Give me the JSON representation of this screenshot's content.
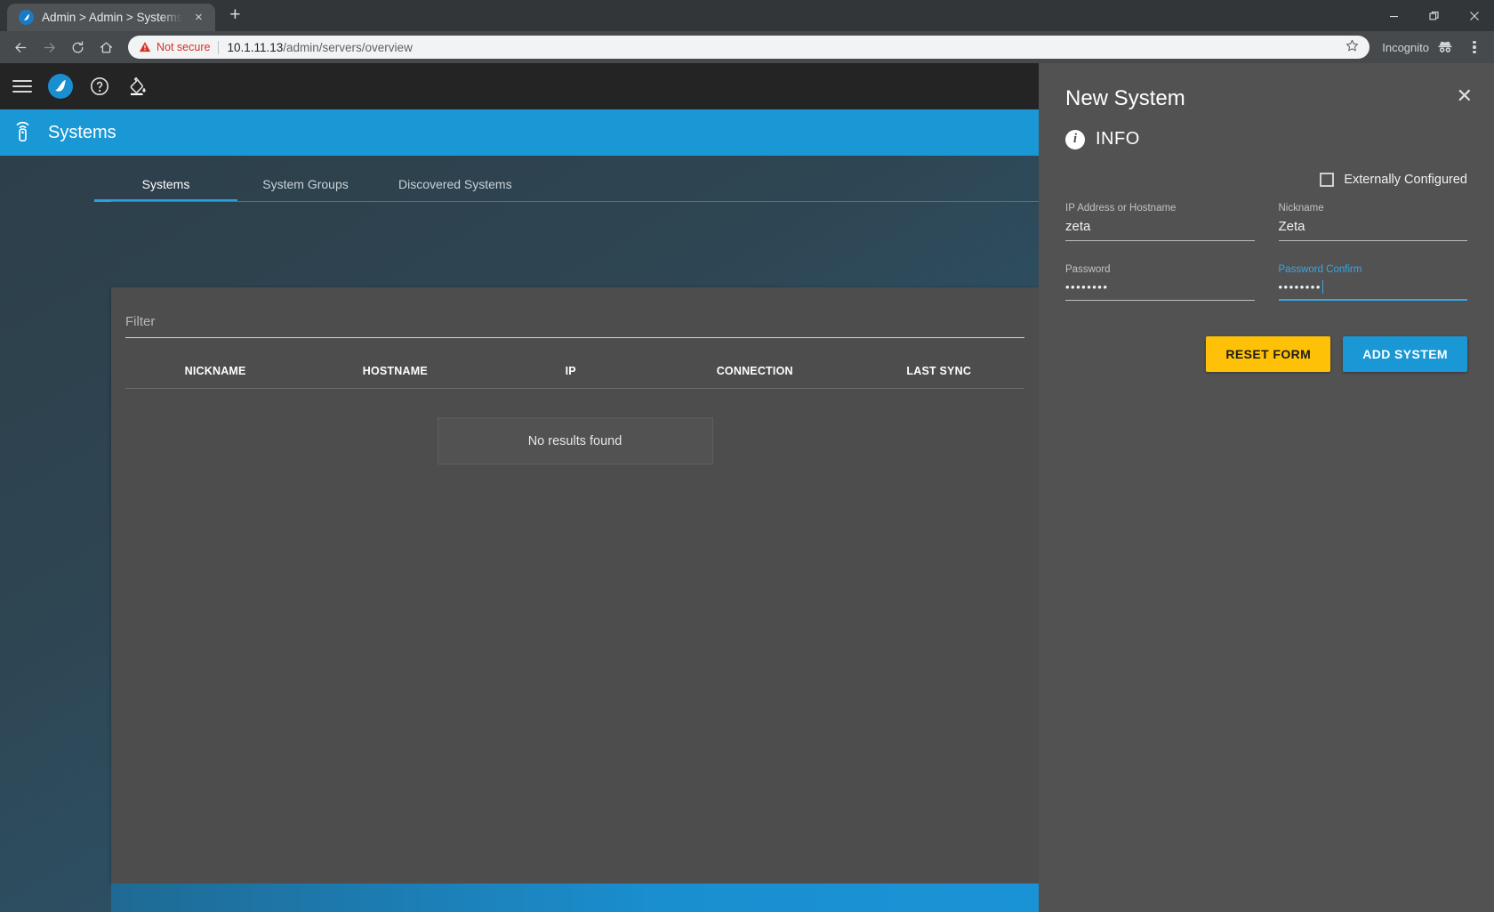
{
  "browser": {
    "tab": {
      "title": "Admin > Admin > Systems",
      "close_label": "×",
      "favicon": "app-logo-icon"
    },
    "newtab_label": "+",
    "window_controls": {
      "minimize": "–",
      "restore": "❐",
      "close": "✕"
    },
    "nav": {
      "back": "←",
      "forward": "→",
      "reload": "↻",
      "home": "⌂"
    },
    "omnibox": {
      "security_label": "Not secure",
      "url_host": "10.1.11.13",
      "url_path": "/admin/servers/overview",
      "bookmark_icon": "star-icon"
    },
    "profile_label": "Incognito",
    "menu_icon": "kebab-menu-icon"
  },
  "appbar": {
    "menu_icon": "hamburger-menu-icon",
    "logo_icon": "brand-logo-icon",
    "help_icon": "help-circle-icon",
    "theme_icon": "paint-fill-icon",
    "settings_icon": "gear-icon",
    "settings_badge_icon": "update-badge-icon",
    "avatar_icon": "user-avatar-icon"
  },
  "page": {
    "icon": "remote-control-icon",
    "title": "Systems"
  },
  "tabs": [
    {
      "label": "Systems",
      "active": true
    },
    {
      "label": "System Groups",
      "active": false
    },
    {
      "label": "Discovered Systems",
      "active": false
    }
  ],
  "table": {
    "filter_placeholder": "Filter",
    "filter_value": "",
    "columns": [
      "NICKNAME",
      "HOSTNAME",
      "IP",
      "CONNECTION",
      "LAST SYNC"
    ],
    "rows": [],
    "empty_message": "No results found"
  },
  "drawer": {
    "title": "New System",
    "close_label": "✕",
    "section_icon": "info-icon",
    "section_label": "INFO",
    "externally_configured": {
      "label": "Externally Configured",
      "checked": false
    },
    "fields": [
      {
        "label": "IP Address or Hostname",
        "value": "zeta",
        "focused": false
      },
      {
        "label": "Nickname",
        "value": "Zeta",
        "focused": false
      },
      {
        "label": "Password",
        "value": "••••••••",
        "focused": false
      },
      {
        "label": "Password Confirm",
        "value": "••••••••",
        "focused": true
      }
    ],
    "buttons": {
      "reset": "RESET FORM",
      "add": "ADD SYSTEM"
    }
  },
  "colors": {
    "accent_blue": "#1a97d5",
    "amber": "#ffc107",
    "drawer_bg": "#525252",
    "focus_blue": "#3ba6e0"
  }
}
